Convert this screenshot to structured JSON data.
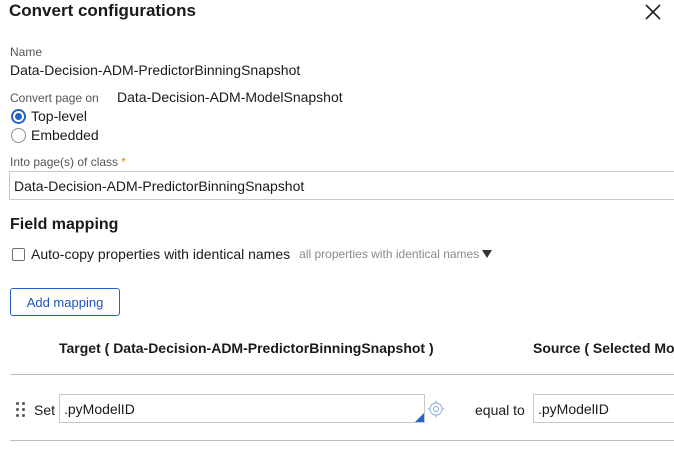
{
  "dialog": {
    "title": "Convert configurations"
  },
  "name": {
    "label": "Name",
    "value": "Data-Decision-ADM-PredictorBinningSnapshot"
  },
  "convert_page": {
    "label": "Convert page on",
    "value": "Data-Decision-ADM-ModelSnapshot",
    "options": [
      {
        "label": "Top-level",
        "checked": true
      },
      {
        "label": "Embedded",
        "checked": false
      }
    ]
  },
  "into_pages": {
    "label": "Into page(s) of class",
    "required_mark": "*",
    "value": "Data-Decision-ADM-PredictorBinningSnapshot"
  },
  "field_mapping": {
    "heading": "Field mapping",
    "auto_copy_label": "Auto-copy properties with identical names",
    "auto_copy_checked": false,
    "auto_copy_select": "all properties with identical names",
    "add_mapping_label": "Add mapping",
    "columns": {
      "target": "Target ( Data-Decision-ADM-PredictorBinningSnapshot )",
      "source": "Source ( Selected Mo"
    },
    "rows": [
      {
        "set_label": "Set",
        "target": ".pyModelID",
        "equal_label": "equal to",
        "source": ".pyModelID"
      }
    ]
  },
  "colors": {
    "accent": "#2563c7",
    "required": "#d98a00",
    "divider": "#bdbdbd"
  }
}
